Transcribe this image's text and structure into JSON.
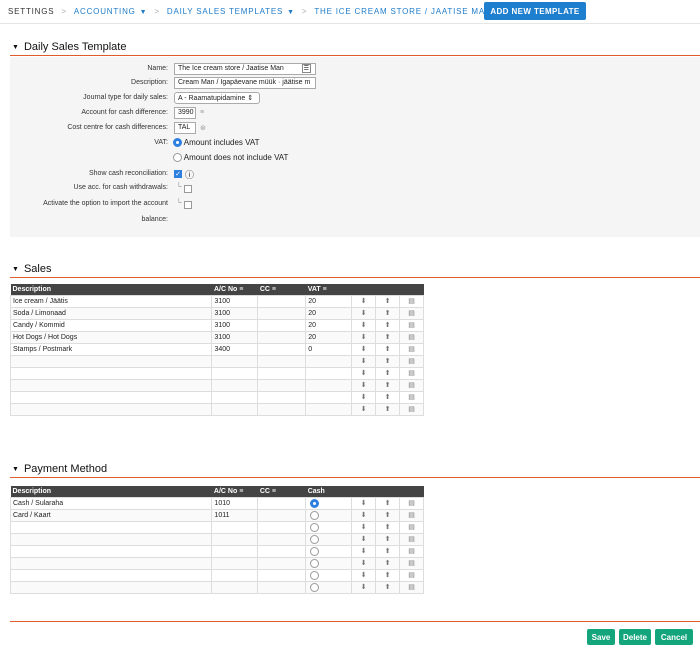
{
  "breadcrumb": {
    "settings": "SETTINGS",
    "accounting": "ACCOUNTING",
    "daily_sales_templates": "DAILY SALES TEMPLATES",
    "current": "THE ICE CREAM STORE / JAATISE MAN",
    "separator": ">",
    "add_button": "ADD NEW TEMPLATE"
  },
  "template_section": {
    "title": "Daily Sales Template",
    "name_label": "Name:",
    "name_value": "The Ice cream store / Jaatise Man",
    "description_label": "Description:",
    "description_value": "Cream Man / Igapäevane müük · jäätise m",
    "journal_type_label": "Journal type for daily sales:",
    "journal_type_value": "A - Raamatupidamine",
    "cash_diff_account_label": "Account for cash difference:",
    "cash_diff_account_value": "3990",
    "cost_centre_label": "Cost centre for cash differences:",
    "cost_centre_value": "TAL",
    "vat_label": "VAT:",
    "vat_option_includes": "Amount includes VAT",
    "vat_option_excludes": "Amount does not include VAT",
    "vat_selected": "includes",
    "show_cash_recon_label": "Show cash reconciliation:",
    "show_cash_recon_checked": true,
    "use_acc_withdrawals_label": "Use acc. for cash withdrawals:",
    "import_balance_label_1": "Activate the option to import the account",
    "import_balance_label_2": "balance:"
  },
  "sales_section": {
    "title": "Sales",
    "headers": [
      "Description",
      "A/C No",
      "CC",
      "VAT"
    ],
    "rows": [
      {
        "desc": "Ice cream / Jäätis",
        "ac": "3100",
        "cc": "",
        "vat": "20"
      },
      {
        "desc": "Soda / Limonaad",
        "ac": "3100",
        "cc": "",
        "vat": "20"
      },
      {
        "desc": "Candy / Kommid",
        "ac": "3100",
        "cc": "",
        "vat": "20"
      },
      {
        "desc": "Hot Dogs / Hot Dogs",
        "ac": "3100",
        "cc": "",
        "vat": "20"
      },
      {
        "desc": "Stamps / Postmark",
        "ac": "3400",
        "cc": "",
        "vat": "0"
      },
      {
        "desc": "",
        "ac": "",
        "cc": "",
        "vat": ""
      },
      {
        "desc": "",
        "ac": "",
        "cc": "",
        "vat": ""
      },
      {
        "desc": "",
        "ac": "",
        "cc": "",
        "vat": ""
      },
      {
        "desc": "",
        "ac": "",
        "cc": "",
        "vat": ""
      },
      {
        "desc": "",
        "ac": "",
        "cc": "",
        "vat": ""
      }
    ]
  },
  "payment_section": {
    "title": "Payment Method",
    "headers": [
      "Description",
      "A/C No",
      "CC",
      "Cash"
    ],
    "rows": [
      {
        "desc": "Cash / Sularaha",
        "ac": "1010",
        "cc": "",
        "cash": true
      },
      {
        "desc": "Card / Kaart",
        "ac": "1011",
        "cc": "",
        "cash": false
      },
      {
        "desc": "",
        "ac": "",
        "cc": "",
        "cash": false
      },
      {
        "desc": "",
        "ac": "",
        "cc": "",
        "cash": false
      },
      {
        "desc": "",
        "ac": "",
        "cc": "",
        "cash": false
      },
      {
        "desc": "",
        "ac": "",
        "cc": "",
        "cash": false
      },
      {
        "desc": "",
        "ac": "",
        "cc": "",
        "cash": false
      },
      {
        "desc": "",
        "ac": "",
        "cc": "",
        "cash": false
      }
    ]
  },
  "footer": {
    "save": "Save",
    "delete": "Delete",
    "cancel": "Cancel"
  },
  "colors": {
    "accent_blue": "#1f7fcf",
    "rule_orange": "#e05a2b",
    "green": "#14a57c"
  }
}
